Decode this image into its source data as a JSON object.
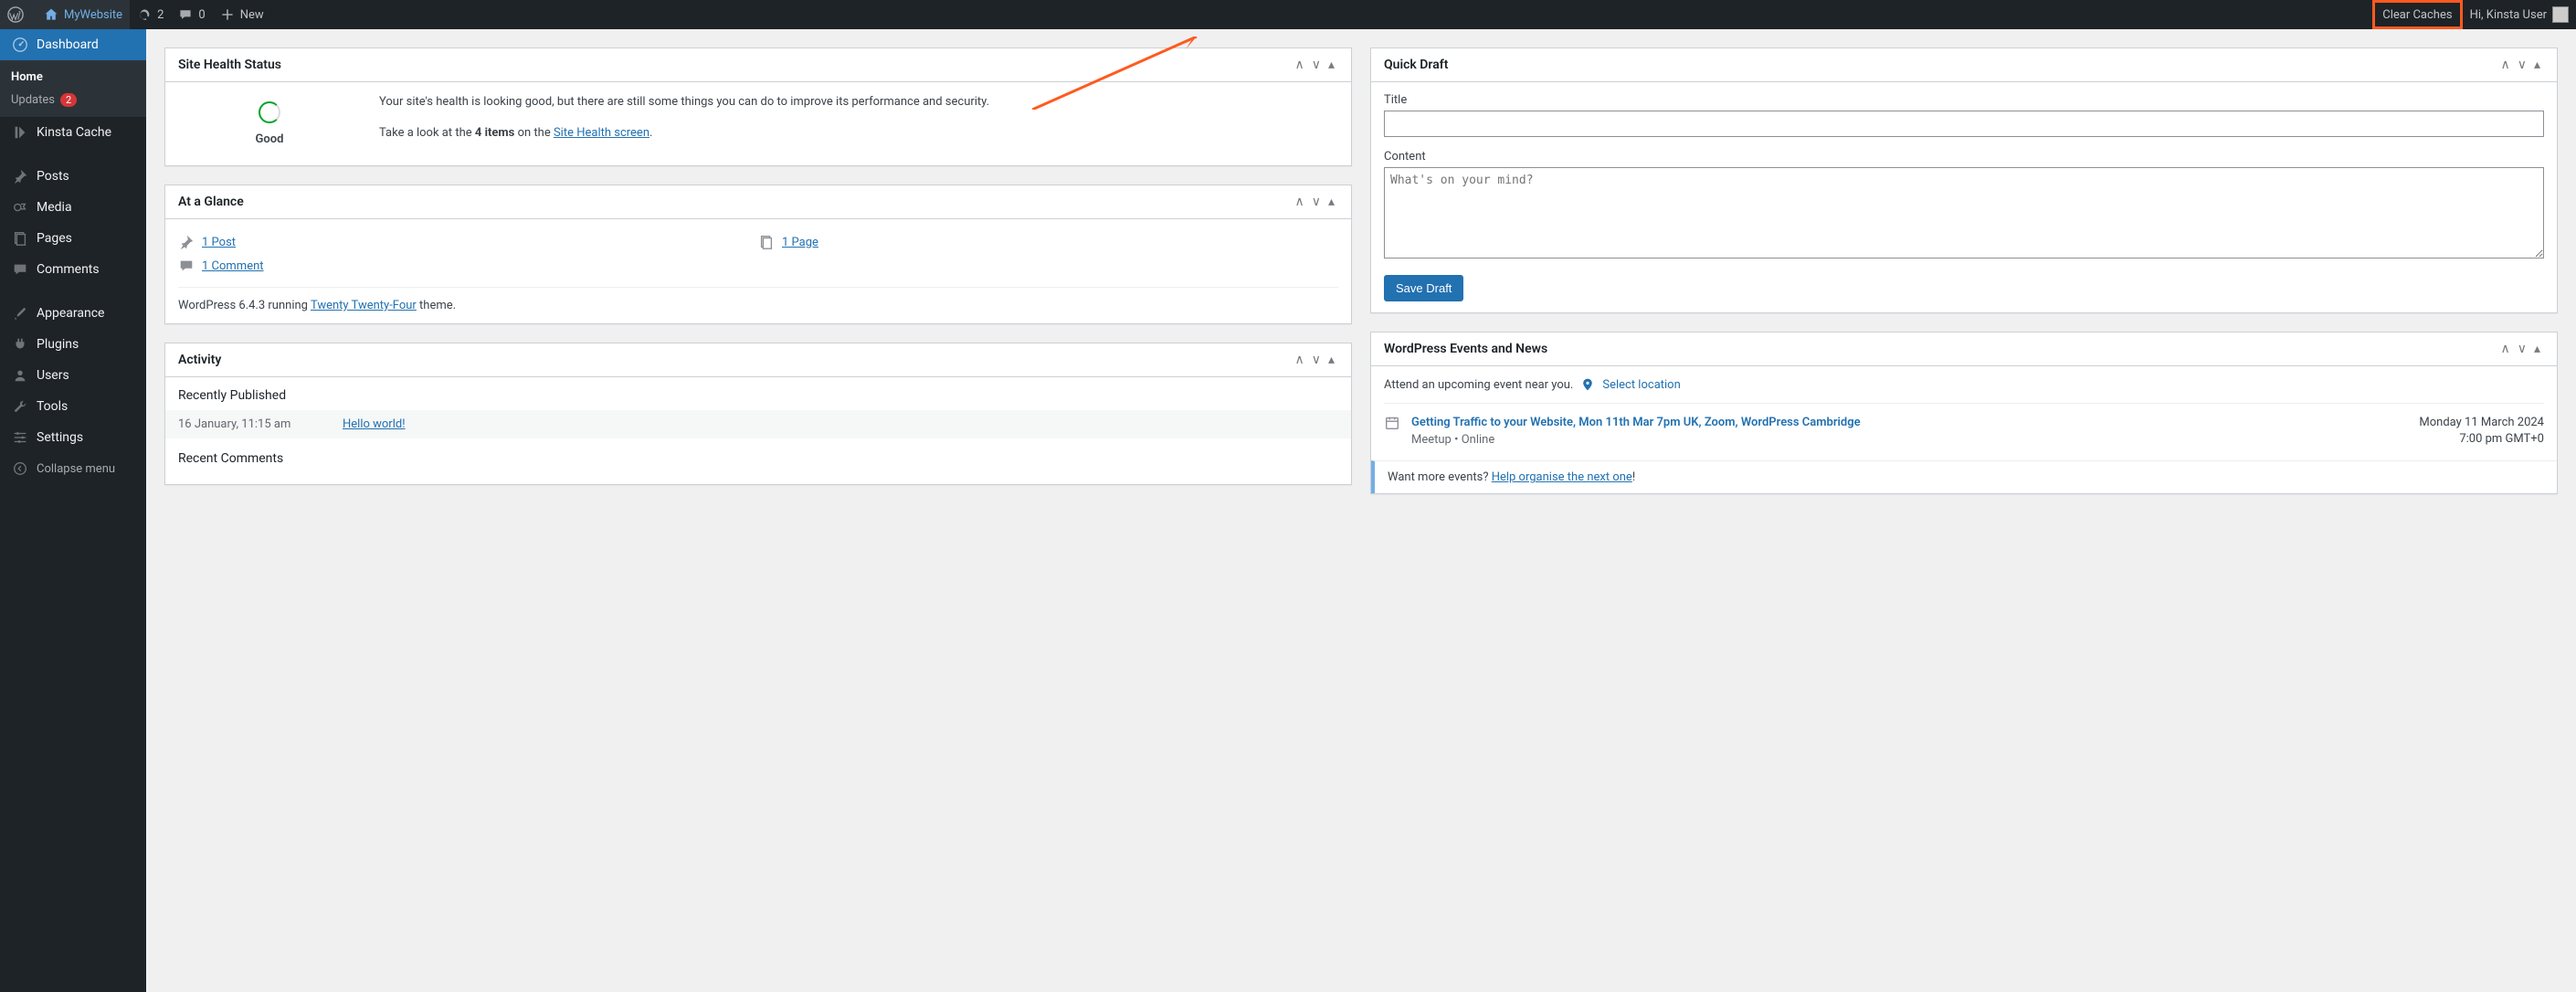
{
  "adminbar": {
    "site_name": "MyWebsite",
    "updates_count": "2",
    "comments_count": "0",
    "new_label": "New",
    "clear_caches": "Clear Caches",
    "greeting": "Hi, Kinsta User"
  },
  "sidebar": {
    "dashboard": "Dashboard",
    "home": "Home",
    "updates": "Updates",
    "updates_badge": "2",
    "kinsta_cache": "Kinsta Cache",
    "posts": "Posts",
    "media": "Media",
    "pages": "Pages",
    "comments": "Comments",
    "appearance": "Appearance",
    "plugins": "Plugins",
    "users": "Users",
    "tools": "Tools",
    "settings": "Settings",
    "collapse": "Collapse menu"
  },
  "site_health": {
    "title": "Site Health Status",
    "status_label": "Good",
    "text1": "Your site's health is looking good, but there are still some things you can do to improve its performance and security.",
    "text2_a": "Take a look at the ",
    "text2_b": "4 items",
    "text2_c": " on the ",
    "text2_link": "Site Health screen",
    "text2_d": "."
  },
  "glance": {
    "title": "At a Glance",
    "posts": "1 Post",
    "pages": "1 Page",
    "comments": "1 Comment",
    "footer_a": "WordPress 6.4.3 running ",
    "footer_link": "Twenty Twenty-Four",
    "footer_b": " theme."
  },
  "activity": {
    "title": "Activity",
    "recently_published": "Recently Published",
    "pub_date": "16 January, 11:15 am",
    "pub_title": "Hello world!",
    "recent_comments": "Recent Comments"
  },
  "quick_draft": {
    "title": "Quick Draft",
    "title_label": "Title",
    "content_label": "Content",
    "content_placeholder": "What's on your mind?",
    "save_button": "Save Draft"
  },
  "events": {
    "title": "WordPress Events and News",
    "attend": "Attend an upcoming event near you.",
    "select_location": "Select location",
    "item_title": "Getting Traffic to your Website, Mon 11th Mar 7pm UK, Zoom, WordPress Cambridge",
    "item_meta": "Meetup • Online",
    "item_date1": "Monday 11 March 2024",
    "item_date2": "7:00 pm GMT+0",
    "footer_a": "Want more events? ",
    "footer_link": "Help organise the next one",
    "footer_b": "!"
  }
}
